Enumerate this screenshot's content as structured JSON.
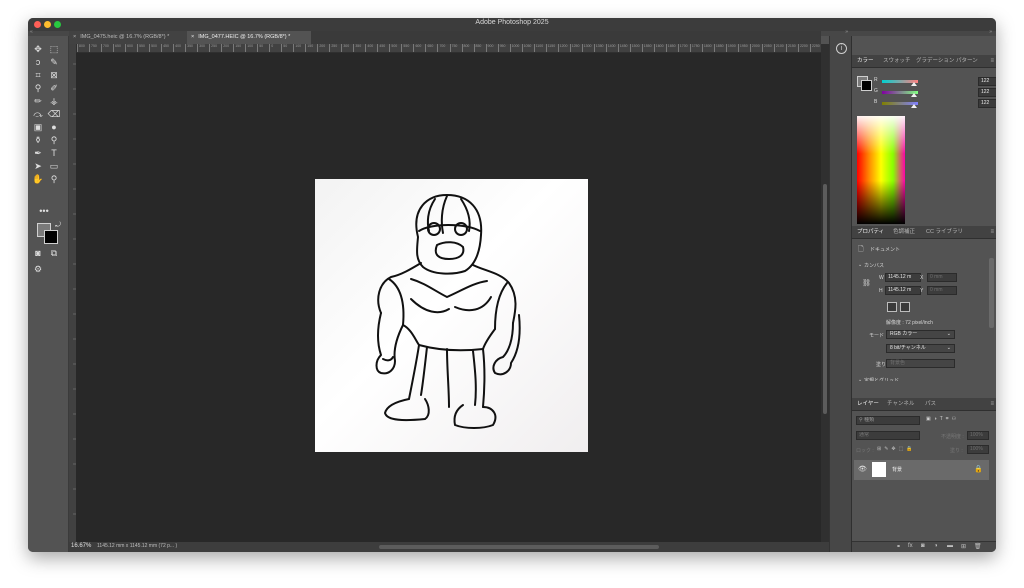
{
  "app": {
    "window_title": "Adobe Photoshop 2025"
  },
  "tabs": [
    {
      "label": "IMG_0475.heic @ 16.7% (RGB/8*) *",
      "close": "×",
      "active": false
    },
    {
      "label": "IMG_0477.HEIC @ 16.7% (RGB/8*) *",
      "close": "×",
      "active": true
    }
  ],
  "ruler": {
    "h_ticks": [
      "800",
      "750",
      "700",
      "650",
      "600",
      "550",
      "500",
      "450",
      "400",
      "350",
      "300",
      "250",
      "200",
      "150",
      "100",
      "50",
      "0",
      "50",
      "100",
      "150",
      "200",
      "250",
      "300",
      "350",
      "400",
      "450",
      "500",
      "550",
      "600",
      "650",
      "700",
      "750",
      "800",
      "850",
      "900",
      "950",
      "1000",
      "1050",
      "1100",
      "1150",
      "1200",
      "1250",
      "1300",
      "1350",
      "1400",
      "1450",
      "1500",
      "1550",
      "1600",
      "1650",
      "1700",
      "1750",
      "1800",
      "1850",
      "1900",
      "1950",
      "2000",
      "2050",
      "2100",
      "2150",
      "2200",
      "2250"
    ]
  },
  "status": {
    "zoom": "16.67%",
    "dimensions": "1145.12 mm x 1145.12 mm (72 p... )"
  },
  "color_panel": {
    "tabs": [
      "カラー",
      "スウォッチ",
      "グラデーション",
      "パターン"
    ],
    "sliders": [
      {
        "label": "R",
        "value": "122",
        "fraction": 0.48,
        "track_start": "#00d0d0",
        "track_end": "#ff8080"
      },
      {
        "label": "G",
        "value": "122",
        "fraction": 0.48,
        "track_start": "#8000a0",
        "track_end": "#80ff80"
      },
      {
        "label": "B",
        "value": "122",
        "fraction": 0.48,
        "track_start": "#808000",
        "track_end": "#8080ff"
      }
    ],
    "foreground_color": "#7a7a7a",
    "background_color": "#000000"
  },
  "properties_panel": {
    "tabs": [
      "プロパティ",
      "色調補正",
      "CC ライブラリ"
    ],
    "doc_label": "ドキュメント",
    "section_canvas": "カンバス",
    "w_label": "W",
    "w_value": "1145.12 m",
    "x_label": "X",
    "x_value": "0 mm",
    "h_label": "H",
    "h_value": "1145.12 m",
    "y_label": "Y",
    "y_value": "0 mm",
    "resolution": "解像度 : 72 pixel/inch",
    "mode_label": "モード",
    "mode_value": "RGB カラー",
    "bit_value": "8 bit/チャンネル",
    "fill_label": "塗り",
    "fill_value": "背景色",
    "section_next": "定規とグリッド"
  },
  "layers_panel": {
    "tabs": [
      "レイヤー",
      "チャンネル",
      "パス"
    ],
    "filter_placeholder": "種類",
    "blend_mode": "通常",
    "opacity_label": "不透明度 :",
    "opacity_value": "100%",
    "lock_label": "ロック :",
    "fill_label": "塗り :",
    "fill_value": "100%",
    "layer_name": "背景",
    "footer_icons": [
      "link-icon",
      "fx-icon",
      "mask-icon",
      "adjustment-icon",
      "folder-icon",
      "new-layer-icon",
      "trash-icon"
    ]
  },
  "tools": [
    {
      "name": "move-tool-icon",
      "glyph": "✥"
    },
    {
      "name": "marquee-tool-icon",
      "glyph": "⬚"
    },
    {
      "name": "lasso-tool-icon",
      "glyph": "ↄ"
    },
    {
      "name": "quick-select-tool-icon",
      "glyph": "✎"
    },
    {
      "name": "crop-tool-icon",
      "glyph": "⌗"
    },
    {
      "name": "frame-tool-icon",
      "glyph": "⊠"
    },
    {
      "name": "eyedropper-tool-icon",
      "glyph": "⚲"
    },
    {
      "name": "healing-brush-tool-icon",
      "glyph": "✐"
    },
    {
      "name": "brush-tool-icon",
      "glyph": "✏"
    },
    {
      "name": "stamp-tool-icon",
      "glyph": "⚶"
    },
    {
      "name": "history-brush-tool-icon",
      "glyph": "⤼"
    },
    {
      "name": "eraser-tool-icon",
      "glyph": "⌫"
    },
    {
      "name": "gradient-tool-icon",
      "glyph": "▣"
    },
    {
      "name": "blur-tool-icon",
      "glyph": "●"
    },
    {
      "name": "dodge-tool-icon",
      "glyph": "⚱"
    },
    {
      "name": "burn-tool-icon",
      "glyph": "⚲"
    },
    {
      "name": "pen-tool-icon",
      "glyph": "✒"
    },
    {
      "name": "type-tool-icon",
      "glyph": "T"
    },
    {
      "name": "path-select-tool-icon",
      "glyph": "➤"
    },
    {
      "name": "shape-tool-icon",
      "glyph": "▭"
    },
    {
      "name": "hand-tool-icon",
      "glyph": "✋"
    },
    {
      "name": "zoom-tool-icon",
      "glyph": "⚲"
    }
  ],
  "toolbar_more": "•••"
}
